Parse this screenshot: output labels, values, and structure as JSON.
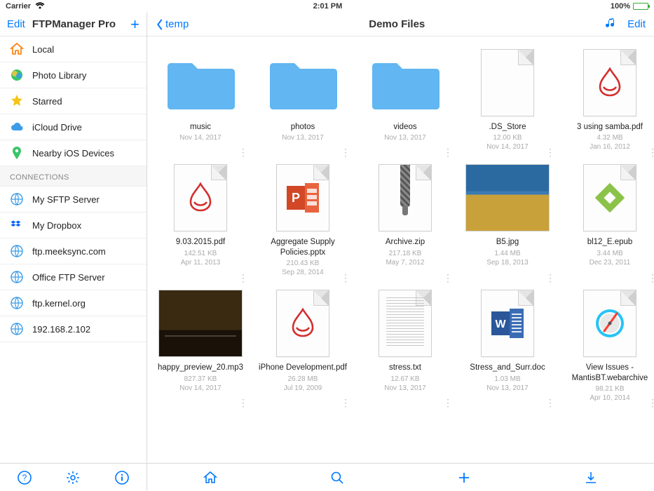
{
  "status": {
    "carrier": "Carrier",
    "time": "2:01 PM",
    "battery": "100%"
  },
  "sidebar": {
    "edit": "Edit",
    "title": "FTPManager Pro",
    "items": [
      {
        "label": "Local"
      },
      {
        "label": "Photo Library"
      },
      {
        "label": "Starred"
      },
      {
        "label": "iCloud Drive"
      },
      {
        "label": "Nearby iOS Devices"
      }
    ],
    "connections_header": "CONNECTIONS",
    "connections": [
      {
        "label": "My SFTP  Server"
      },
      {
        "label": "My Dropbox"
      },
      {
        "label": "ftp.meeksync.com"
      },
      {
        "label": "Office FTP Server"
      },
      {
        "label": "ftp.kernel.org"
      },
      {
        "label": "192.168.2.102"
      }
    ]
  },
  "content": {
    "back": "temp",
    "title": "Demo Files",
    "edit": "Edit"
  },
  "files": [
    {
      "name": "music",
      "type": "folder",
      "size": "",
      "date": "Nov 14, 2017"
    },
    {
      "name": "photos",
      "type": "folder",
      "size": "",
      "date": "Nov 13, 2017"
    },
    {
      "name": "videos",
      "type": "folder",
      "size": "",
      "date": "Nov 13, 2017"
    },
    {
      "name": ".DS_Store",
      "type": "blank",
      "size": "12.00 KB",
      "date": "Nov 14, 2017"
    },
    {
      "name": "3 using samba.pdf",
      "type": "pdf",
      "size": "4.32 MB",
      "date": "Jan 16, 2012"
    },
    {
      "name": "9.03.2015.pdf",
      "type": "pdf",
      "size": "142.51 KB",
      "date": "Apr 11, 2013"
    },
    {
      "name": "Aggregate Supply Policies.pptx",
      "type": "pptx",
      "size": "210.43 KB",
      "date": "Sep 28, 2014"
    },
    {
      "name": "Archive.zip",
      "type": "zip",
      "size": "217.18 KB",
      "date": "May 7, 2012"
    },
    {
      "name": "B5.jpg",
      "type": "photo-landscape",
      "size": "1.44 MB",
      "date": "Sep 18, 2013"
    },
    {
      "name": "bl12_E.epub",
      "type": "epub",
      "size": "3.44 MB",
      "date": "Dec 23, 2011"
    },
    {
      "name": "happy_preview_20.mp3",
      "type": "photo-dark",
      "size": "827.37 KB",
      "date": "Nov 14, 2017"
    },
    {
      "name": "iPhone Development.pdf",
      "type": "pdf",
      "size": "26.28 MB",
      "date": "Jul 19, 2009"
    },
    {
      "name": "stress.txt",
      "type": "txt",
      "size": "12.67 KB",
      "date": "Nov 13, 2017"
    },
    {
      "name": "Stress_and_Surr.doc",
      "type": "doc",
      "size": "1.03 MB",
      "date": "Nov 13, 2017"
    },
    {
      "name": "View Issues - MantisBT.webarchive",
      "type": "webarchive",
      "size": "98.21 KB",
      "date": "Apr 10, 2014"
    }
  ]
}
